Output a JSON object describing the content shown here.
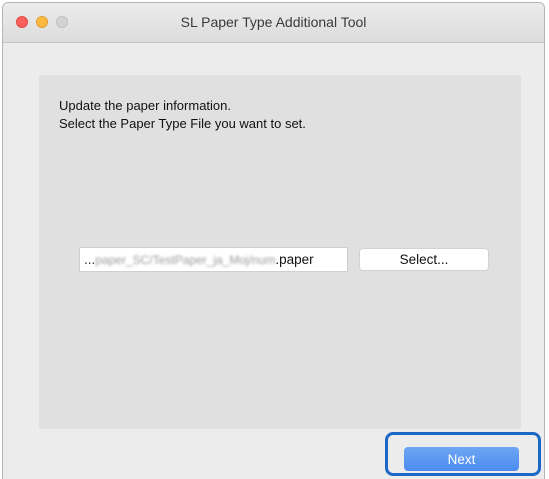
{
  "window": {
    "title": "SL Paper Type Additional Tool"
  },
  "instructions": {
    "line1": "Update the paper information.",
    "line2": "Select the Paper Type File you want to set."
  },
  "file_field": {
    "prefix": "...",
    "obscured_path": "paper_SC/TestPaper_ja_Moj/num",
    "extension": ".paper"
  },
  "buttons": {
    "select_label": "Select...",
    "next_label": "Next"
  },
  "colors": {
    "window_background": "#ececec",
    "panel_background": "#e0e0e0",
    "close_button": "#fc605c",
    "minimize_button": "#fcbb40",
    "zoom_button_inactive": "#d3d3d3",
    "next_button": "#4b8cf0",
    "highlight_frame": "#1b68c6"
  }
}
